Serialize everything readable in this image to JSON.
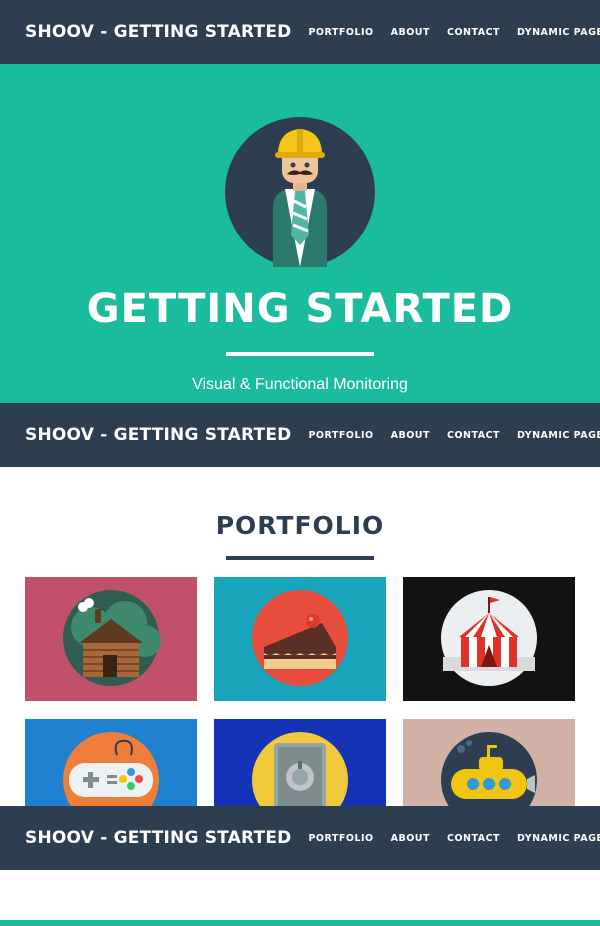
{
  "navbar": {
    "brand": "SHOOV - GETTING STARTED",
    "links": [
      "PORTFOLIO",
      "ABOUT",
      "CONTACT",
      "DYNAMIC PAGE"
    ]
  },
  "hero": {
    "title": "GETTING STARTED",
    "subtitle": "Visual & Functional Monitoring"
  },
  "portfolio": {
    "heading": "PORTFOLIO",
    "items": [
      {
        "name": "cabin",
        "color": "#c0506a"
      },
      {
        "name": "cake",
        "color": "#18a5bb"
      },
      {
        "name": "circus",
        "color": "#141210"
      },
      {
        "name": "game",
        "color": "#1f80cf"
      },
      {
        "name": "safe",
        "color": "#1632b4"
      },
      {
        "name": "submarine",
        "color": "#d2b2a6"
      }
    ]
  },
  "colors": {
    "navbar": "#2c3e50",
    "accent": "#1abc9c",
    "white": "#ffffff"
  }
}
